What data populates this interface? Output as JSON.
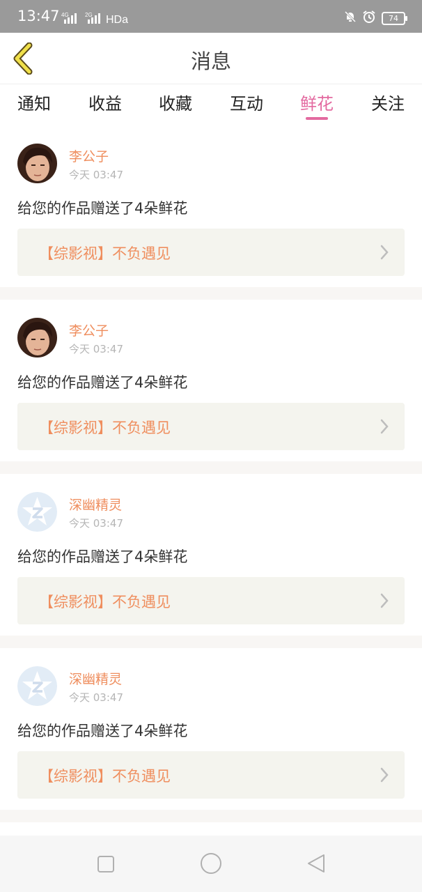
{
  "status": {
    "time": "13:47",
    "network": "46 ..ıl 26 ..ıl HDa",
    "battery": "74"
  },
  "header": {
    "title": "消息"
  },
  "tabs": [
    {
      "label": "通知"
    },
    {
      "label": "收益"
    },
    {
      "label": "收藏"
    },
    {
      "label": "互动"
    },
    {
      "label": "鲜花",
      "active": true
    },
    {
      "label": "关注"
    }
  ],
  "messages": [
    {
      "user": "李公子",
      "time": "今天 03:47",
      "text": "给您的作品赠送了4朵鲜花",
      "work": "【综影视】不负遇见",
      "avatar": "photo"
    },
    {
      "user": "李公子",
      "time": "今天 03:47",
      "text": "给您的作品赠送了4朵鲜花",
      "work": "【综影视】不负遇见",
      "avatar": "photo"
    },
    {
      "user": "深幽精灵",
      "time": "今天 03:47",
      "text": "给您的作品赠送了4朵鲜花",
      "work": "【综影视】不负遇见",
      "avatar": "default-star"
    },
    {
      "user": "深幽精灵",
      "time": "今天 03:47",
      "text": "给您的作品赠送了4朵鲜花",
      "work": "【综影视】不负遇见",
      "avatar": "default-star"
    }
  ],
  "colors": {
    "accent": "#e36aa0",
    "name": "#ef8e5e",
    "box": "#f4f4ee"
  }
}
